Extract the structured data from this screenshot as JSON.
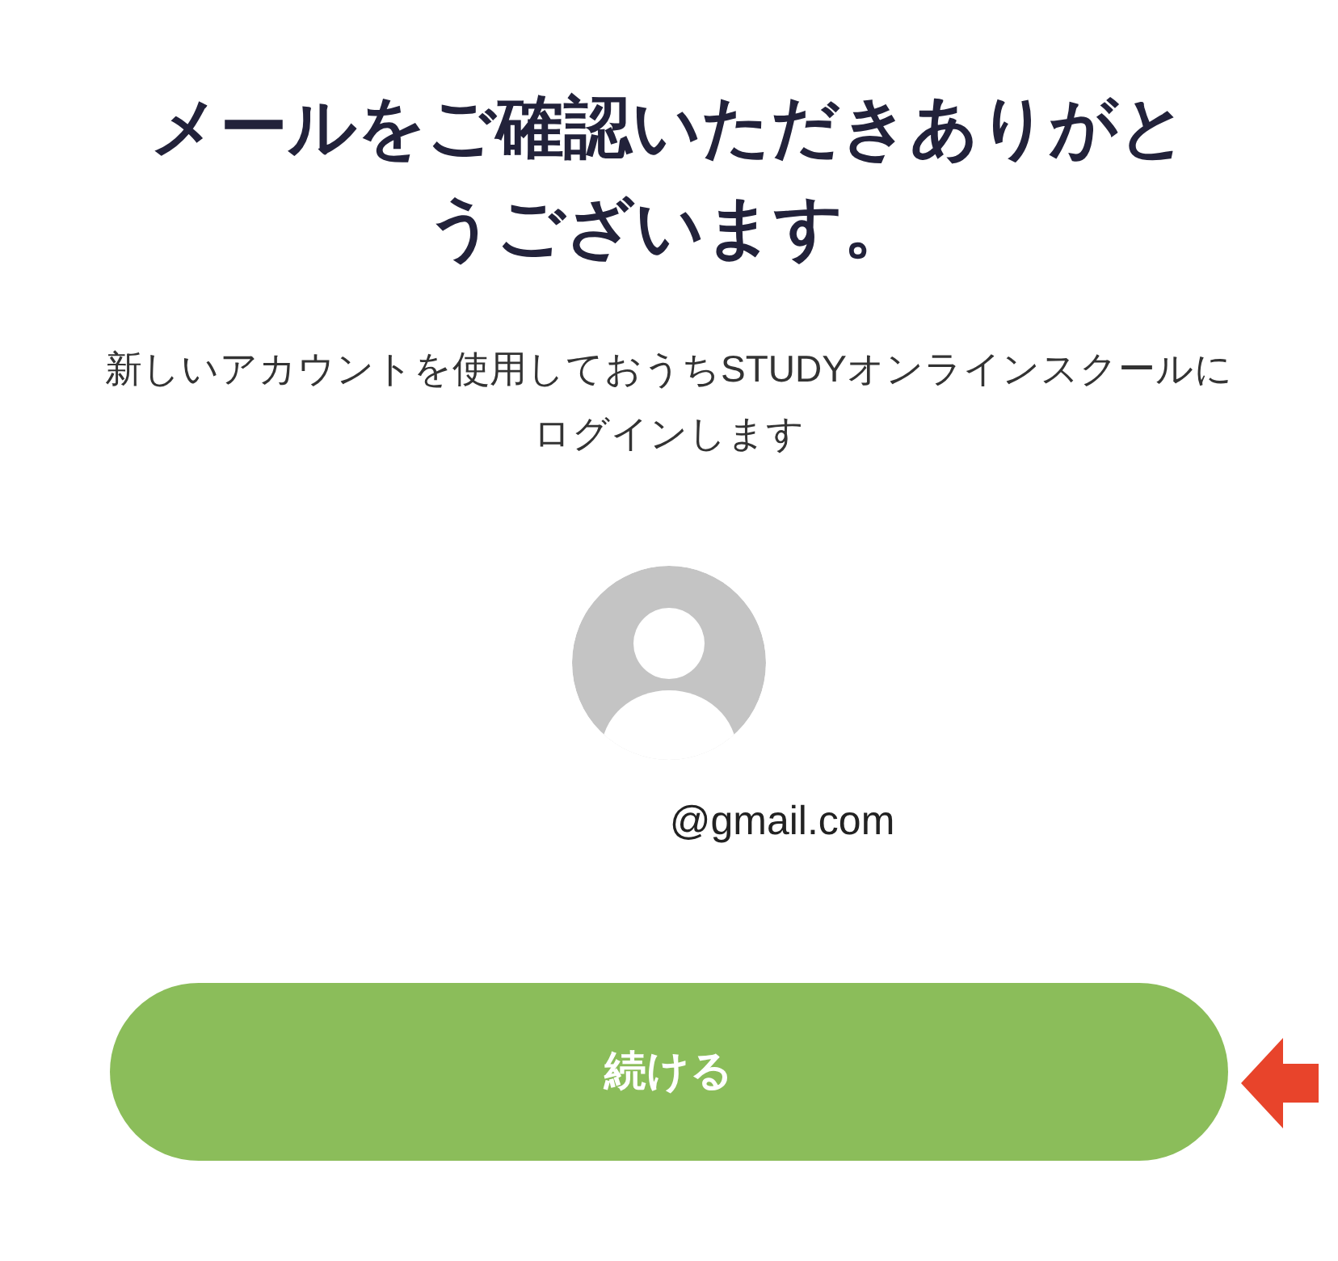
{
  "title": "メールをご確認いただきありがとうございます。",
  "message": "新しいアカウントを使用しておうちSTUDYオンラインスクールにログインします",
  "email": "@gmail.com",
  "continue_button": {
    "label": "続ける"
  }
}
